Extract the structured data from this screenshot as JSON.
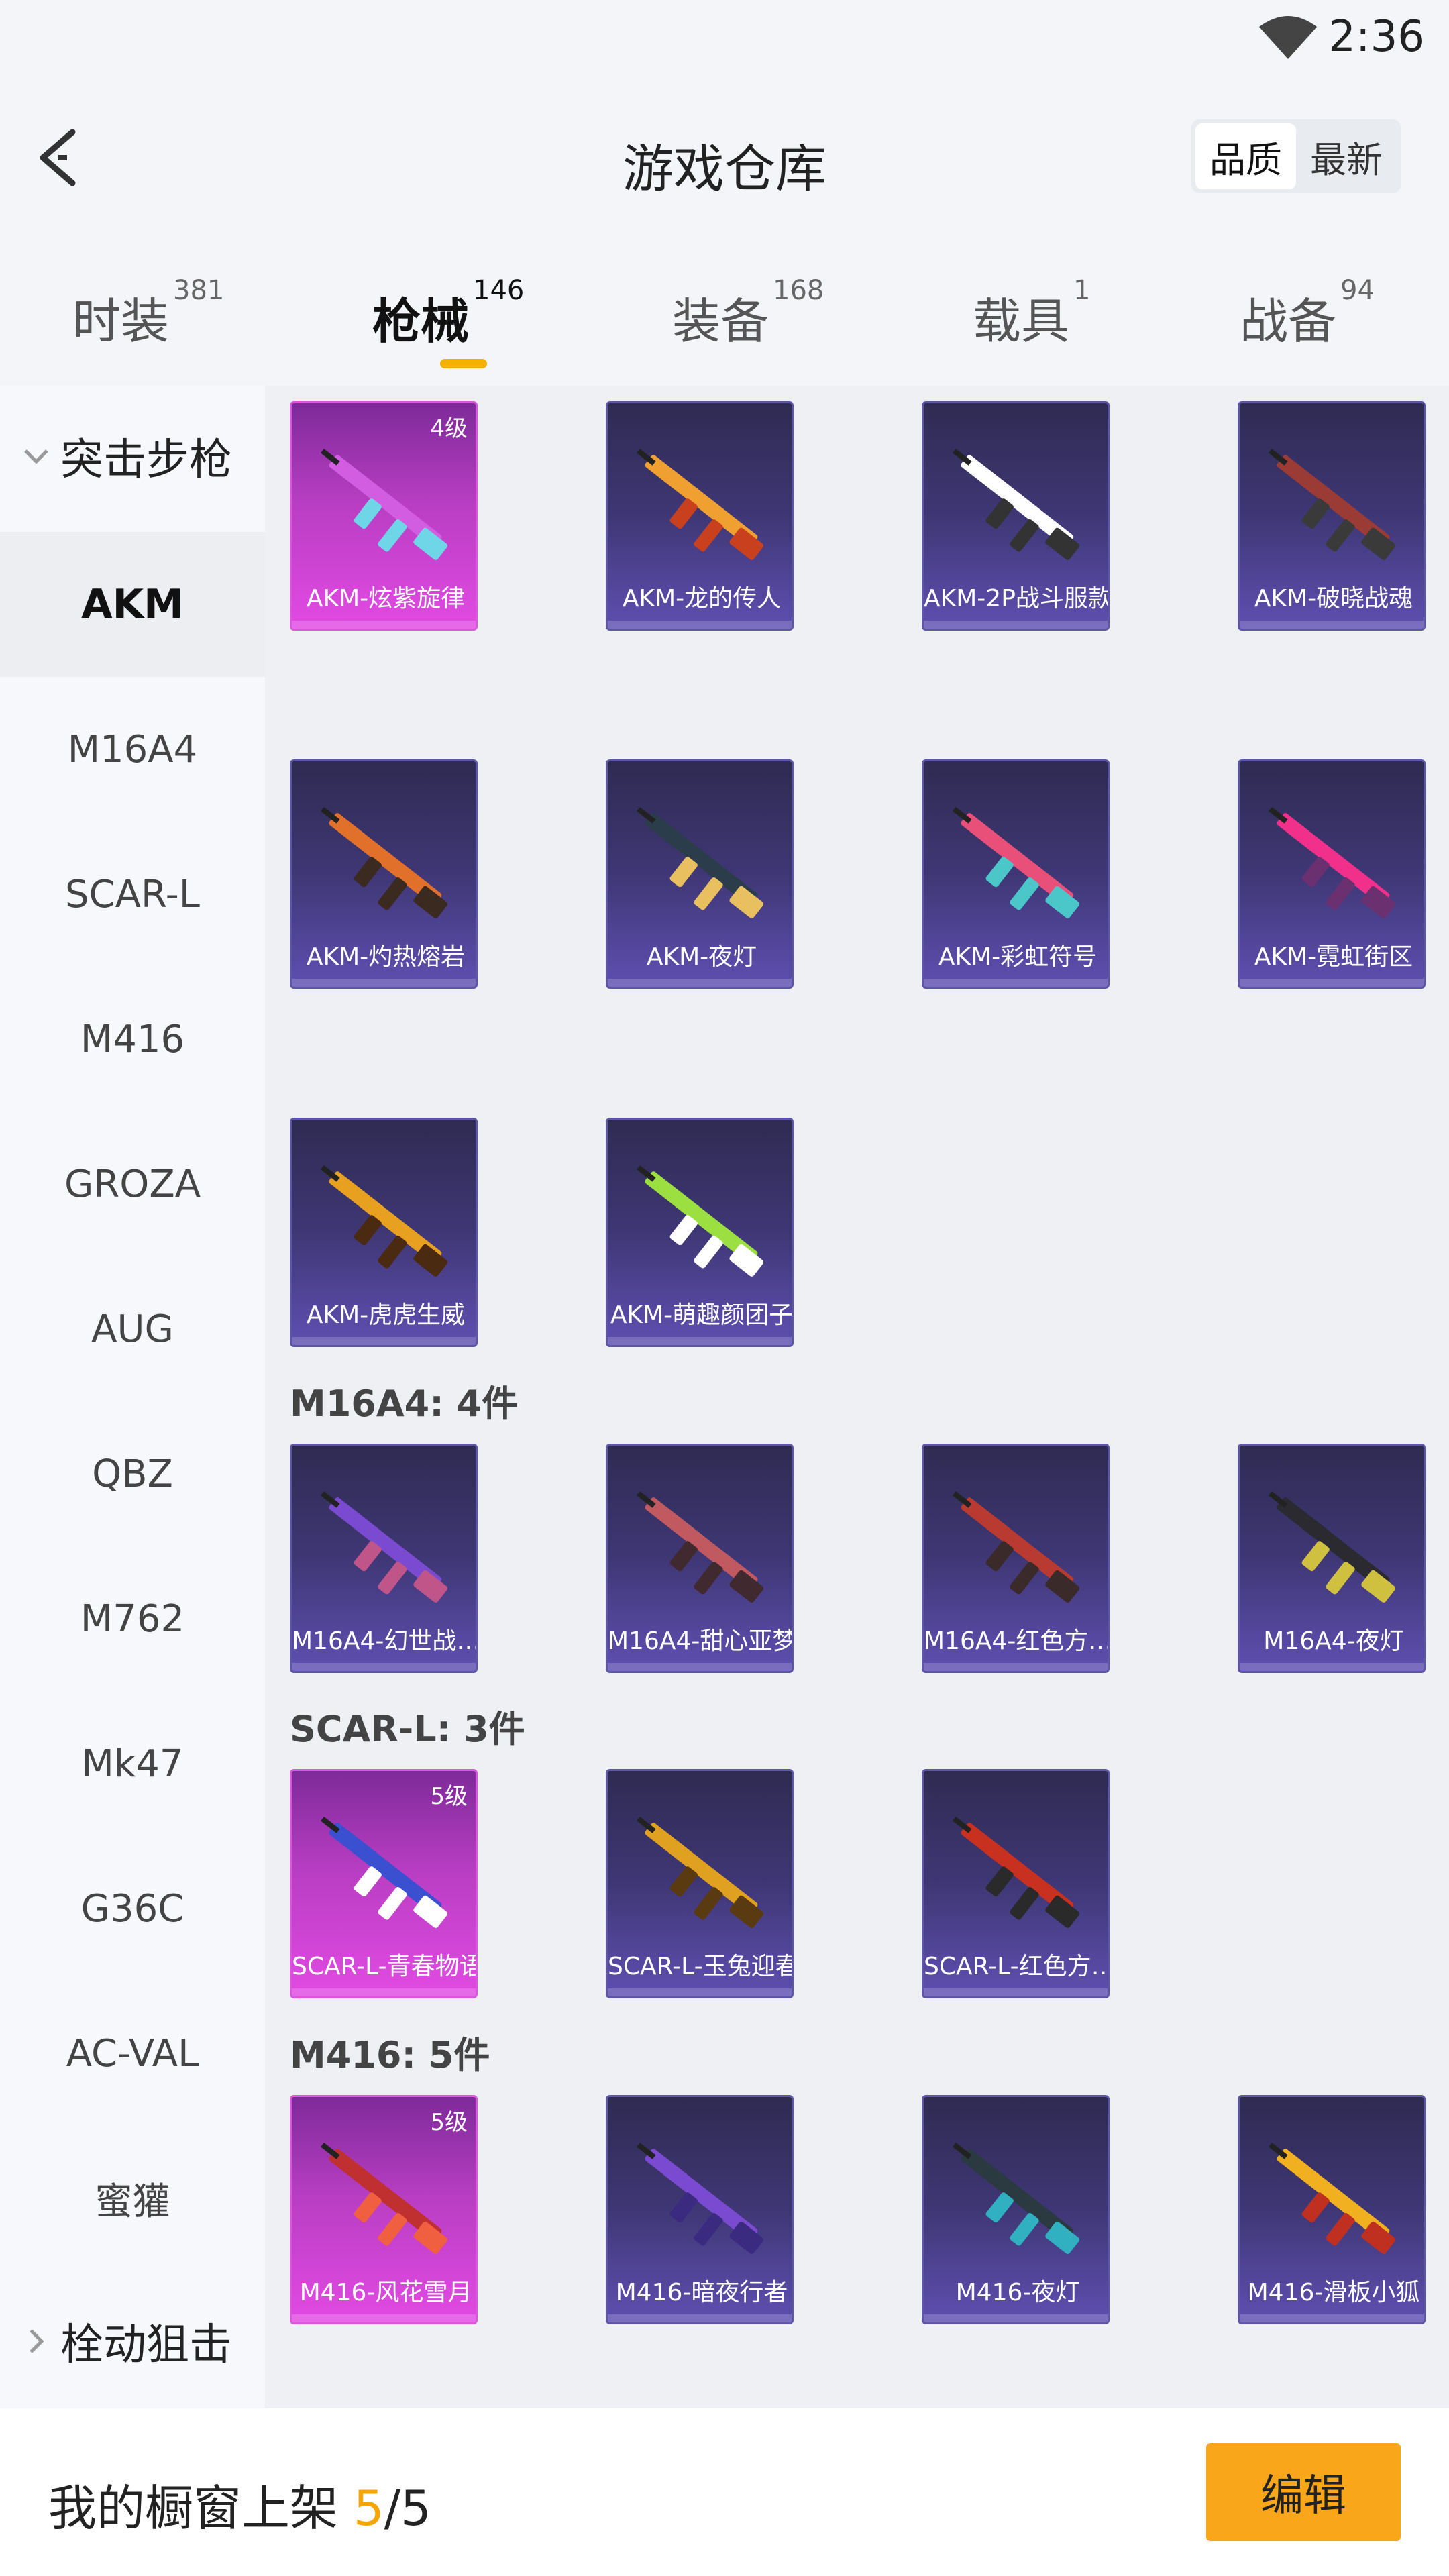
{
  "status_bar": {
    "time": "2:36"
  },
  "header": {
    "title": "游戏仓库",
    "sort_options": [
      "品质",
      "最新"
    ]
  },
  "tabs": [
    {
      "label": "时装",
      "count": "381"
    },
    {
      "label": "枪械",
      "count": "146",
      "active": true
    },
    {
      "label": "装备",
      "count": "168"
    },
    {
      "label": "载具",
      "count": "1"
    },
    {
      "label": "战备",
      "count": "94"
    }
  ],
  "sidebar": {
    "group_top": "突击步枪",
    "items": [
      "AKM",
      "M16A4",
      "SCAR-L",
      "M416",
      "GROZA",
      "AUG",
      "QBZ",
      "M762",
      "Mk47",
      "G36C",
      "AC-VAL",
      "蜜獾"
    ],
    "group_bottom": "栓动狙击"
  },
  "sections": [
    {
      "title": "M16A4: 4件"
    },
    {
      "title": "SCAR-L: 3件"
    },
    {
      "title": "M416: 5件"
    }
  ],
  "cards": [
    {
      "name": "AKM-炫紫旋律",
      "level": "4级",
      "quality": "purple",
      "icon": "akm-rifle-icon"
    },
    {
      "name": "AKM-龙的传人",
      "level": "",
      "quality": "blue",
      "icon": "akm-rifle-icon"
    },
    {
      "name": "AKM-2P战斗服款",
      "level": "",
      "quality": "blue",
      "icon": "akm-rifle-icon"
    },
    {
      "name": "AKM-破晓战魂",
      "level": "",
      "quality": "blue",
      "icon": "akm-rifle-icon"
    },
    {
      "name": "AKM-灼热熔岩",
      "level": "",
      "quality": "blue",
      "icon": "akm-rifle-icon"
    },
    {
      "name": "AKM-夜灯",
      "level": "",
      "quality": "blue",
      "icon": "akm-rifle-icon"
    },
    {
      "name": "AKM-彩虹符号",
      "level": "",
      "quality": "blue",
      "icon": "akm-rifle-icon"
    },
    {
      "name": "AKM-霓虹街区",
      "level": "",
      "quality": "blue",
      "icon": "akm-rifle-icon"
    },
    {
      "name": "AKM-虎虎生威",
      "level": "",
      "quality": "blue",
      "icon": "akm-rifle-icon"
    },
    {
      "name": "AKM-萌趣颜团子",
      "level": "",
      "quality": "blue",
      "icon": "akm-rifle-icon"
    },
    {
      "name": "M16A4-幻世战…",
      "level": "",
      "quality": "blue",
      "icon": "m16a4-rifle-icon"
    },
    {
      "name": "M16A4-甜心亚梦",
      "level": "",
      "quality": "blue",
      "icon": "m16a4-rifle-icon"
    },
    {
      "name": "M16A4-红色方…",
      "level": "",
      "quality": "blue",
      "icon": "m16a4-rifle-icon"
    },
    {
      "name": "M16A4-夜灯",
      "level": "",
      "quality": "blue",
      "icon": "m16a4-rifle-icon"
    },
    {
      "name": "SCAR-L-青春物语",
      "level": "5级",
      "quality": "purple",
      "icon": "scar-l-rifle-icon"
    },
    {
      "name": "SCAR-L-玉兔迎春",
      "level": "",
      "quality": "blue",
      "icon": "scar-l-rifle-icon"
    },
    {
      "name": "SCAR-L-红色方…",
      "level": "",
      "quality": "blue",
      "icon": "scar-l-rifle-icon"
    },
    {
      "name": "M416-风花雪月",
      "level": "5级",
      "quality": "purple",
      "icon": "m416-rifle-icon"
    },
    {
      "name": "M416-暗夜行者",
      "level": "",
      "quality": "blue",
      "icon": "m416-rifle-icon"
    },
    {
      "name": "M416-夜灯",
      "level": "",
      "quality": "blue",
      "icon": "m416-rifle-icon"
    },
    {
      "name": "M416-滑板小狐",
      "level": "",
      "quality": "blue",
      "icon": "m416-rifle-icon"
    }
  ],
  "bottom_bar": {
    "label": "我的橱窗上架",
    "current": "5",
    "total": "/5",
    "edit_label": "编辑"
  },
  "colors": {
    "accent": "#f5b100",
    "button": "#f9a61a",
    "card_blue": "#3f3775",
    "card_purple": "#c33fca"
  }
}
